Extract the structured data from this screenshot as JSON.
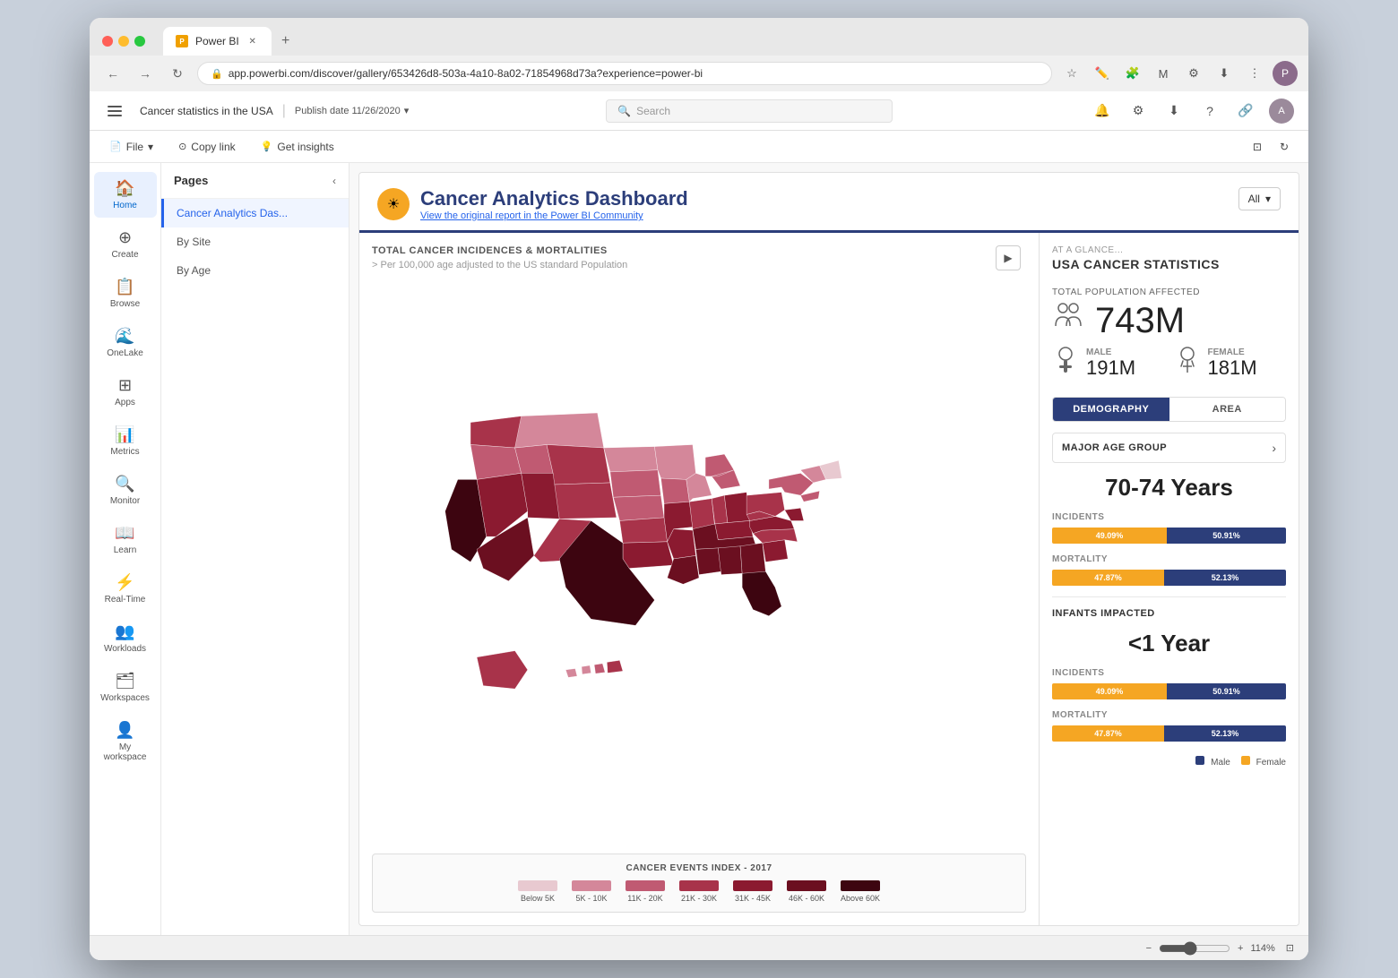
{
  "browser": {
    "tab_label": "Power BI",
    "url": "app.powerbi.com/discover/gallery/653426d8-503a-4a10-8a02-71854968d73a?experience=power-bi",
    "new_tab_icon": "+"
  },
  "app": {
    "report_title": "Cancer statistics in the USA",
    "publish_date": "Publish date 11/26/2020",
    "search_placeholder": "Search",
    "subtoolbar": {
      "file_label": "File",
      "copy_label": "Copy link",
      "insights_label": "Get insights"
    }
  },
  "left_nav": {
    "items": [
      {
        "id": "home",
        "label": "Home",
        "icon": "🏠",
        "active": true
      },
      {
        "id": "create",
        "label": "Create",
        "icon": "⊕"
      },
      {
        "id": "browse",
        "label": "Browse",
        "icon": "📋"
      },
      {
        "id": "onelake",
        "label": "OneLake",
        "icon": "🌊"
      },
      {
        "id": "apps",
        "label": "Apps",
        "icon": "⊞"
      },
      {
        "id": "metrics",
        "label": "Metrics",
        "icon": "📊"
      },
      {
        "id": "monitor",
        "label": "Monitor",
        "icon": "🔍"
      },
      {
        "id": "learn",
        "label": "Learn",
        "icon": "📖"
      },
      {
        "id": "realtime",
        "label": "Real-Time",
        "icon": "⚡"
      },
      {
        "id": "workloads",
        "label": "Workloads",
        "icon": "👥"
      },
      {
        "id": "workspaces",
        "label": "Workspaces",
        "icon": "🗂"
      },
      {
        "id": "myworkspace",
        "label": "My workspace",
        "icon": "👤"
      }
    ]
  },
  "pages": {
    "title": "Pages",
    "items": [
      {
        "id": "cancer-dash",
        "label": "Cancer Analytics Das...",
        "active": true
      },
      {
        "id": "by-site",
        "label": "By Site",
        "active": false
      },
      {
        "id": "by-age",
        "label": "By Age",
        "active": false
      }
    ]
  },
  "report": {
    "title": "Cancer Analytics Dashboard",
    "subtitle_link": "View the original report in the Power BI Community",
    "filter_label": "All",
    "map_section_title": "TOTAL CANCER INCIDENCES & MORTALITIES",
    "map_section_subtitle": "> Per 100,000 age adjusted to the US standard Population",
    "legend_title": "CANCER EVENTS INDEX - 2017",
    "legend_items": [
      {
        "label": "Below 5K",
        "color": "#e8c9d0"
      },
      {
        "label": "5K - 10K",
        "color": "#d4879a"
      },
      {
        "label": "11K - 20K",
        "color": "#c05a72"
      },
      {
        "label": "21K - 30K",
        "color": "#a8334a"
      },
      {
        "label": "31K - 45K",
        "color": "#8b1a30"
      },
      {
        "label": "46K - 60K",
        "color": "#6b0f20"
      },
      {
        "label": "Above 60K",
        "color": "#3d0510"
      }
    ],
    "stats": {
      "at_glance": "AT A GLANCE...",
      "main_title": "USA CANCER STATISTICS",
      "total_pop_label": "TOTAL POPULATION AFFECTED",
      "total_number": "743M",
      "male_label": "MALE",
      "male_number": "191M",
      "female_label": "FEMALE",
      "female_number": "181M",
      "demo_tab_active": "DEMOGRAPHY",
      "demo_tab_inactive": "AREA",
      "age_group_label": "MAJOR AGE GROUP",
      "age_value": "70-74 Years",
      "incidents_label": "INCIDENTS",
      "incidents_pct_orange": "49.09%",
      "incidents_pct_navy": "50.91%",
      "incidents_orange_pct": 49.09,
      "incidents_navy_pct": 50.91,
      "mortality_label": "MORTALITY",
      "mortality_pct_orange": "47.87%",
      "mortality_pct_navy": "52.13%",
      "mortality_orange_pct": 47.87,
      "mortality_navy_pct": 52.13,
      "infants_label": "INFANTS IMPACTED",
      "infants_value": "<1 Year",
      "infants_incidents_label": "INCIDENTS",
      "infants_incidents_pct_orange": "49.09%",
      "infants_incidents_pct_navy": "50.91%",
      "infants_incidents_orange_pct": 49.09,
      "infants_incidents_navy_pct": 50.91,
      "infants_mortality_label": "MORTALITY",
      "infants_mortality_pct_orange": "47.87%",
      "infants_mortality_pct_navy": "52.13%",
      "infants_mortality_orange_pct": 47.87,
      "infants_mortality_navy_pct": 52.13,
      "legend_male": "Male",
      "legend_female": "Female"
    }
  },
  "zoom": {
    "percent": "114%"
  }
}
